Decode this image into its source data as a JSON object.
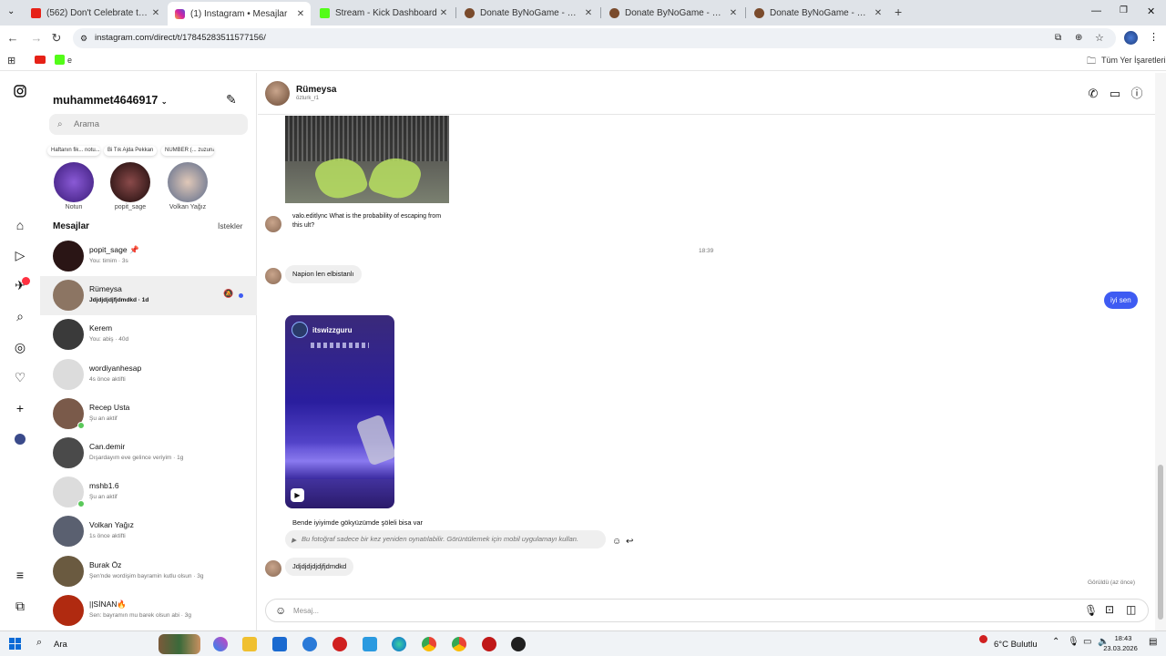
{
  "browser": {
    "tabs": [
      {
        "label": "(562) Don't Celebrate too Early!",
        "color": "#e62117",
        "active": false
      },
      {
        "label": "(1) Instagram • Mesajlar",
        "color": "#d6249f",
        "active": true
      },
      {
        "label": "Stream - Kick Dashboard",
        "color": "#53fc18",
        "active": false
      },
      {
        "label": "Donate ByNoGame - Streamer",
        "color": "#7a4b2c",
        "active": false
      },
      {
        "label": "Donate ByNoGame - BNG Stream",
        "color": "#7a4b2c",
        "active": false
      },
      {
        "label": "Donate ByNoGame - BNG Stream",
        "color": "#7a4b2c",
        "active": false
      }
    ],
    "new_tab": "+",
    "url": "instagram.com/direct/t/17845283511577156/",
    "bookmarks_right": "Tüm Yer İşaretleri",
    "bookmark_k": "e"
  },
  "sidebar": {
    "username": "muhammet4646917",
    "search_placeholder": "Arama",
    "notes": [
      {
        "bubble": "Haftanın fik... notu...",
        "name": "Notun",
        "color": "#5b2fa8"
      },
      {
        "bubble": "Bi Tık  Ajda Pekkan",
        "name": "popit_sage",
        "color": "#3a1d1d"
      },
      {
        "bubble": "NUMBER (... zuzuna  Bu saattem so...",
        "name": "Volkan Yağız",
        "color": "#b0b8c8"
      }
    ],
    "messages_heading": "Mesajlar",
    "requests_label": "İstekler",
    "conversations": [
      {
        "name": "popit_sage 📌",
        "preview": "You: timim · 3s",
        "color": "#2a1515",
        "online": false,
        "selected": false
      },
      {
        "name": "Rümeysa",
        "preview": "Jdjdjdjdjfjdmdkd · 1d",
        "color": "#8c7563",
        "online": false,
        "selected": true
      },
      {
        "name": "Kerem",
        "preview": "You: abiş · 40d",
        "color": "#3a3a3a",
        "online": false,
        "selected": false
      },
      {
        "name": "wordiyanhesap",
        "preview": "4s önce aktifti",
        "color": "#dcdcdc",
        "online": false,
        "selected": false
      },
      {
        "name": "Recep Usta",
        "preview": "Şu an aktif",
        "color": "#7a5a4a",
        "online": true,
        "selected": false
      },
      {
        "name": "Can.demir",
        "preview": "Dışardayım eve gelince veriyim · 1g",
        "color": "#4a4a4a",
        "online": false,
        "selected": false
      },
      {
        "name": "mshb1.6",
        "preview": "Şu an aktif",
        "color": "#dcdcdc",
        "online": true,
        "selected": false
      },
      {
        "name": "Volkan Yağız",
        "preview": "1s önce aktifti",
        "color": "#5a6070",
        "online": false,
        "selected": false
      },
      {
        "name": "Burak Öz",
        "preview": "Şen'nde wordişim bayramin kutlu olsun · 3g",
        "color": "#6a5a40",
        "online": false,
        "selected": false
      },
      {
        "name": "||SİNAN🔥",
        "preview": "Sen: bayramın mu barek olsun abi · 3g",
        "color": "#b02a10",
        "online": false,
        "selected": false
      }
    ]
  },
  "chat": {
    "name": "Rümeysa",
    "subtitle": "özturk_r1",
    "messages": {
      "shared_caption": "valo.editlync What is the probability of escaping from this ult?",
      "timestamp": "18:39",
      "in1": "Napion len elbistanlı",
      "out1": "iyi sen",
      "reel_user": "itswizzguru",
      "in2": "Bende iyiyimde gökyüzümde şöleli bisa var",
      "expired_photo": "Bu fotoğraf sadece bir kez yeniden oynatılabilir. Görüntülemek için mobil uygulamayı kullan.",
      "in3": "Jdjdjdjdjdjfjdmdkd",
      "seen": "Görüldü (az önce)"
    },
    "composer_placeholder": "Mesaj..."
  },
  "taskbar": {
    "search_label": "Ara",
    "weather": "6°C  Bulutlu",
    "time": "18:43",
    "date": "23.03.2026"
  }
}
